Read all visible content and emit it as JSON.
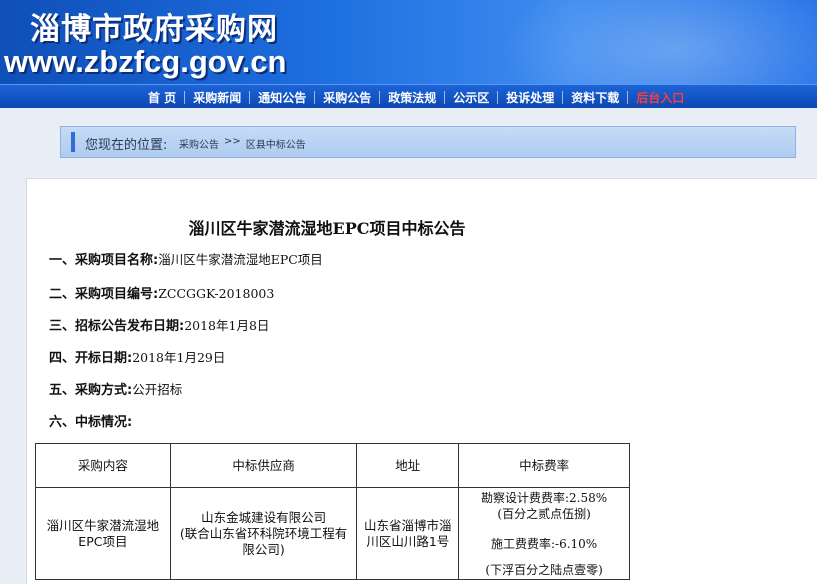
{
  "header": {
    "site_name": "淄博市政府采购网",
    "site_url": "www.zbzfcg.gov.cn"
  },
  "nav": {
    "items": [
      {
        "label": "首 页"
      },
      {
        "label": "采购新闻"
      },
      {
        "label": "通知公告"
      },
      {
        "label": "采购公告"
      },
      {
        "label": "政策法规"
      },
      {
        "label": "公示区"
      },
      {
        "label": "投诉处理"
      },
      {
        "label": "资料下载"
      },
      {
        "label": "后台入口"
      }
    ],
    "highlight_color": "#ff3b3b"
  },
  "breadcrumb": {
    "label": "您现在的位置:",
    "crumbs": [
      "采购公告",
      ">>",
      "区县中标公告"
    ]
  },
  "notice": {
    "title": "淄川区牛家潜流湿地EPC项目中标公告",
    "sections": [
      {
        "key": "一、采购项目名称:",
        "value": "淄川区牛家潜流湿地EPC项目"
      },
      {
        "key": "二、采购项目编号:",
        "value": "ZCCGGK-2018003"
      },
      {
        "key": "三、招标公告发布日期:",
        "value": "2018年1月8日"
      },
      {
        "key": "四、开标日期:",
        "value": "2018年1月29日"
      },
      {
        "key": "五、采购方式:",
        "value": "公开招标"
      },
      {
        "key": "六、中标情况:",
        "value": ""
      }
    ],
    "table": {
      "headers": [
        "采购内容",
        "中标供应商",
        "地址",
        "中标费率"
      ],
      "row": {
        "content": "淄川区牛家潜流湿地EPC项目",
        "supplier_line1": "山东金城建设有限公司",
        "supplier_line2": "(联合山东省环科院环境工程有限公司)",
        "address": "山东省淄博市淄川区山川路1号",
        "fee_lines": [
          "勘察设计费费率:2.58%",
          "(百分之贰点伍捌)",
          "施工费费率:-6.10%",
          "(下浮百分之陆点壹零)"
        ]
      }
    }
  }
}
